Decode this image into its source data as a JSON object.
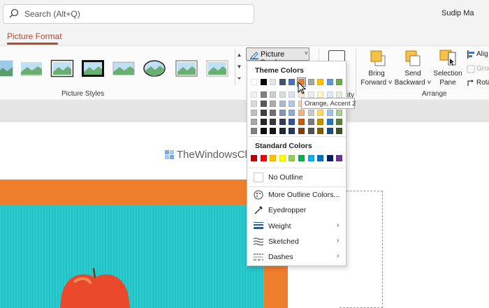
{
  "search": {
    "placeholder": "Search (Alt+Q)"
  },
  "user": {
    "name": "Sudip Ma"
  },
  "tabs": {
    "active": "Picture Format"
  },
  "ribbon": {
    "picture_styles_label": "Picture Styles",
    "picture_border_label": "Picture Border",
    "arrange_label": "Arrange",
    "bring_forward": [
      "Bring",
      "Forward ˅"
    ],
    "send_backward": [
      "Send",
      "Backward ˅"
    ],
    "selection_pane": [
      "Selection",
      "Pane"
    ],
    "align": "Alig",
    "group": "Grou",
    "rotate": "Rota",
    "partial_label": "ity"
  },
  "menu": {
    "theme_colors_header": "Theme Colors",
    "standard_colors_header": "Standard Colors",
    "theme_colors": [
      "#ffffff",
      "#000000",
      "#e7e6e6",
      "#44546a",
      "#4472c4",
      "#ed7d31",
      "#a5a5a5",
      "#ffc000",
      "#5b9bd5",
      "#70ad47"
    ],
    "shade_columns": [
      [
        "#f2f2f2",
        "#d9d9d9",
        "#bfbfbf",
        "#a6a6a6",
        "#808080"
      ],
      [
        "#7f7f7f",
        "#595959",
        "#404040",
        "#262626",
        "#0d0d0d"
      ],
      [
        "#d0cece",
        "#aeabab",
        "#757171",
        "#3a3838",
        "#171616"
      ],
      [
        "#d6dce5",
        "#adb9ca",
        "#8497b0",
        "#333f50",
        "#222a35"
      ],
      [
        "#dae3f3",
        "#b4c7e7",
        "#8faadc",
        "#2f5597",
        "#203864"
      ],
      [
        "#fbe5d6",
        "#f8cbad",
        "#f4b183",
        "#c55a11",
        "#843c0c"
      ],
      [
        "#ededed",
        "#dbdbdb",
        "#c9c9c9",
        "#7b7b7b",
        "#525252"
      ],
      [
        "#fff2cc",
        "#ffe699",
        "#ffd966",
        "#bf9000",
        "#7f6000"
      ],
      [
        "#deebf7",
        "#bdd7ee",
        "#9dc3e6",
        "#2e75b6",
        "#1f4e79"
      ],
      [
        "#e2f0d9",
        "#c5e0b4",
        "#a9d18e",
        "#548235",
        "#385723"
      ]
    ],
    "standard_colors": [
      "#c00000",
      "#ff0000",
      "#ffc000",
      "#ffff00",
      "#92d050",
      "#00b050",
      "#00b0f0",
      "#0070c0",
      "#002060",
      "#7030a0"
    ],
    "selected_color": "#ed7d31",
    "no_outline": "No Outline",
    "more_outline_colors": "More Outline Colors...",
    "eyedropper": "Eyedropper",
    "weight": "Weight",
    "sketched": "Sketched",
    "dashes": "Dashes"
  },
  "tooltip": {
    "text": "Orange, Accent 2"
  },
  "slide": {
    "watermark": "TheWindowsClub"
  },
  "colors": {
    "accent": "#b7472a",
    "orange_fill": "#ef7e2c",
    "teal_fill": "#22c8cc"
  }
}
